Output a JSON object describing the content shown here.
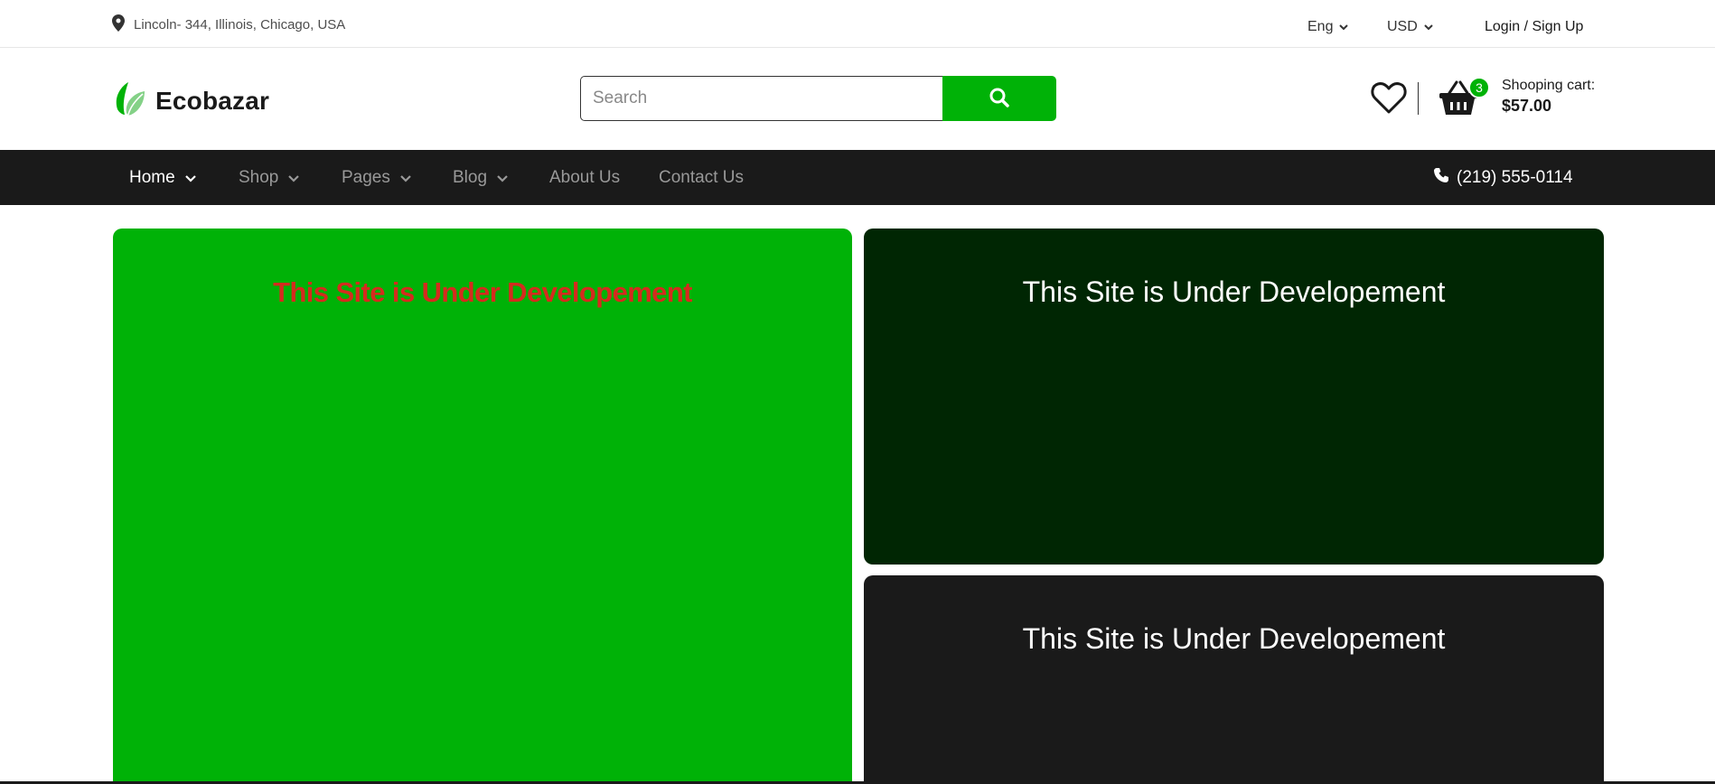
{
  "topbar": {
    "location": "Lincoln- 344, Illinois, Chicago, USA",
    "language": "Eng",
    "currency": "USD",
    "login": "Login / Sign Up"
  },
  "header": {
    "brand": "Ecobazar",
    "search": {
      "placeholder": "Search"
    },
    "cart": {
      "count": "3",
      "label": "Shooping cart:",
      "total": "$57.00"
    }
  },
  "nav": {
    "items": [
      {
        "label": "Home",
        "active": true,
        "dropdown": true
      },
      {
        "label": "Shop",
        "dropdown": true
      },
      {
        "label": "Pages",
        "dropdown": true
      },
      {
        "label": "Blog",
        "dropdown": true
      },
      {
        "label": "About Us"
      },
      {
        "label": "Contact Us"
      }
    ],
    "phone": "(219) 555-0114"
  },
  "panels": [
    {
      "text": "This Site is Under Developement"
    },
    {
      "text": "This Site is Under Developement"
    },
    {
      "text": "This Site is Under Developement"
    }
  ],
  "colors": {
    "accent": "#00b207",
    "nav_bg": "#1a1a1a",
    "panel_dark": "#002603",
    "panel_gray": "#1a1a1a",
    "alert_text": "#d52b1e"
  }
}
